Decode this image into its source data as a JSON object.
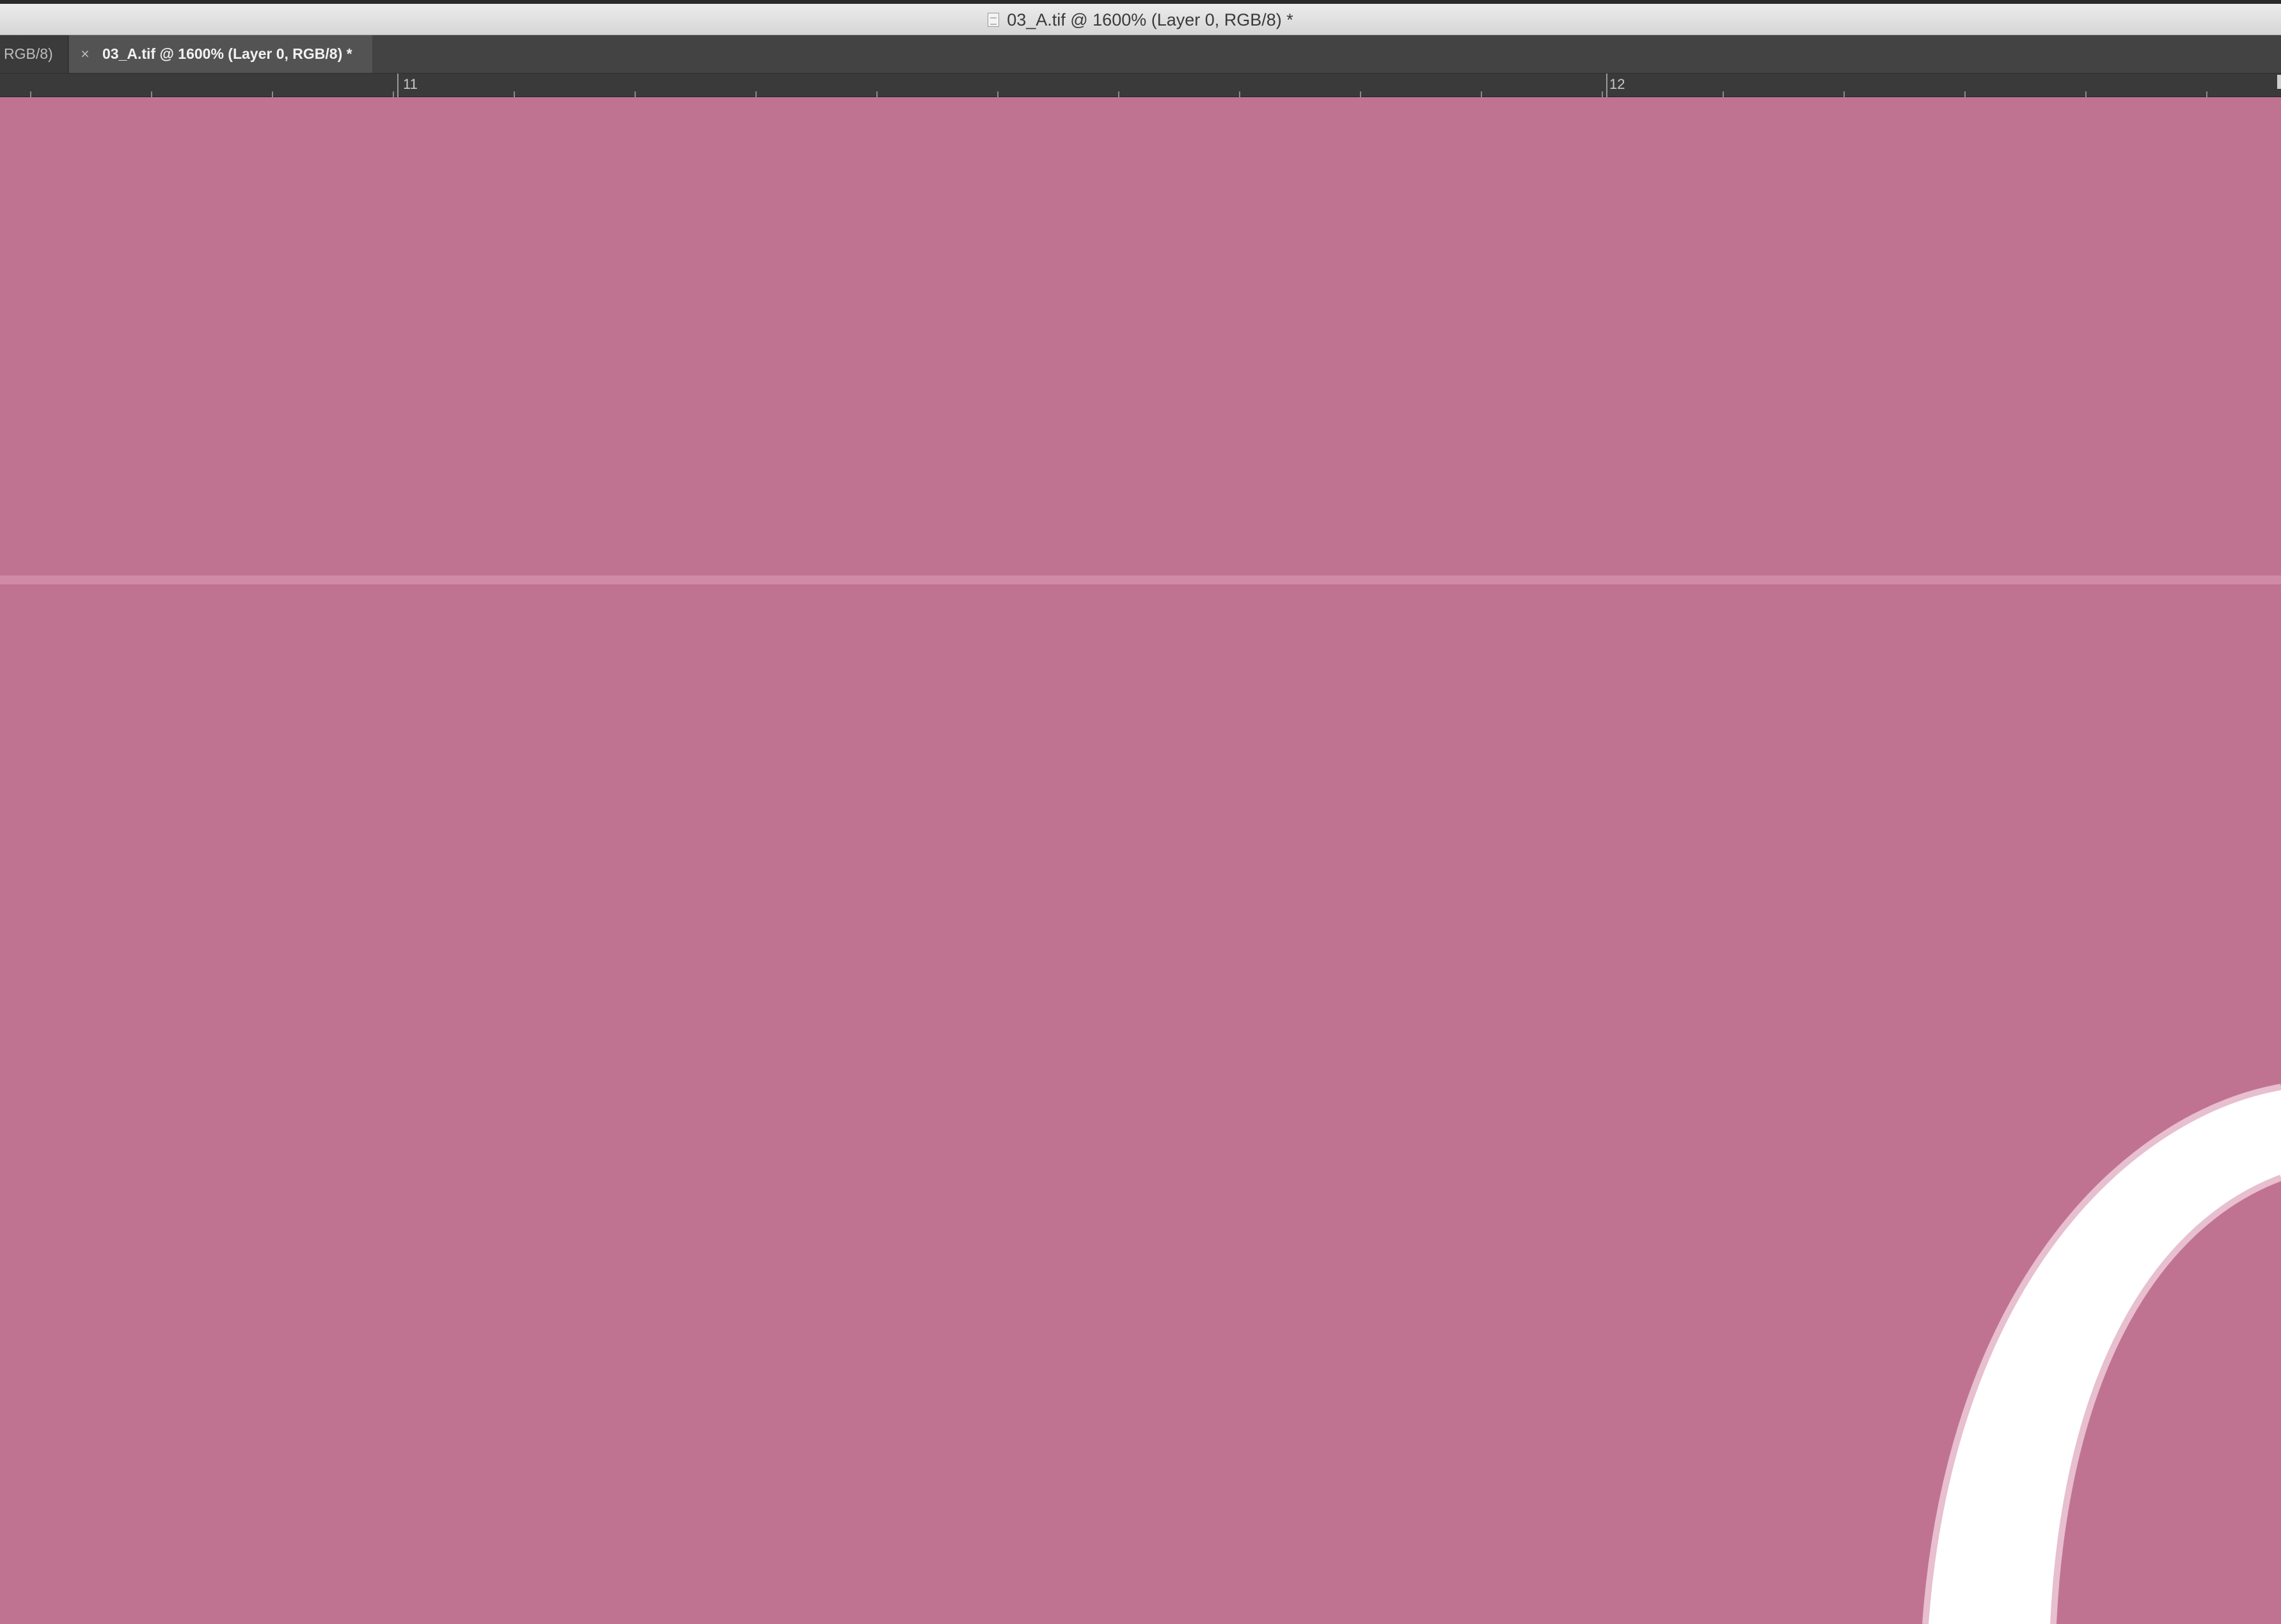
{
  "window": {
    "title": "03_A.tif @ 1600% (Layer 0, RGB/8) *",
    "doc_icon": "document-icon"
  },
  "tabs": [
    {
      "label": "RGB/8)",
      "active": false
    },
    {
      "label": "03_A.tif @ 1600% (Layer 0, RGB/8) *",
      "active": true,
      "close_glyph": "×"
    }
  ],
  "ruler": {
    "labels": [
      "11",
      "12"
    ]
  },
  "canvas": {
    "fill_color": "#c07390",
    "guide_color": "#d08aa5",
    "stroke_color": "#ffffff"
  }
}
